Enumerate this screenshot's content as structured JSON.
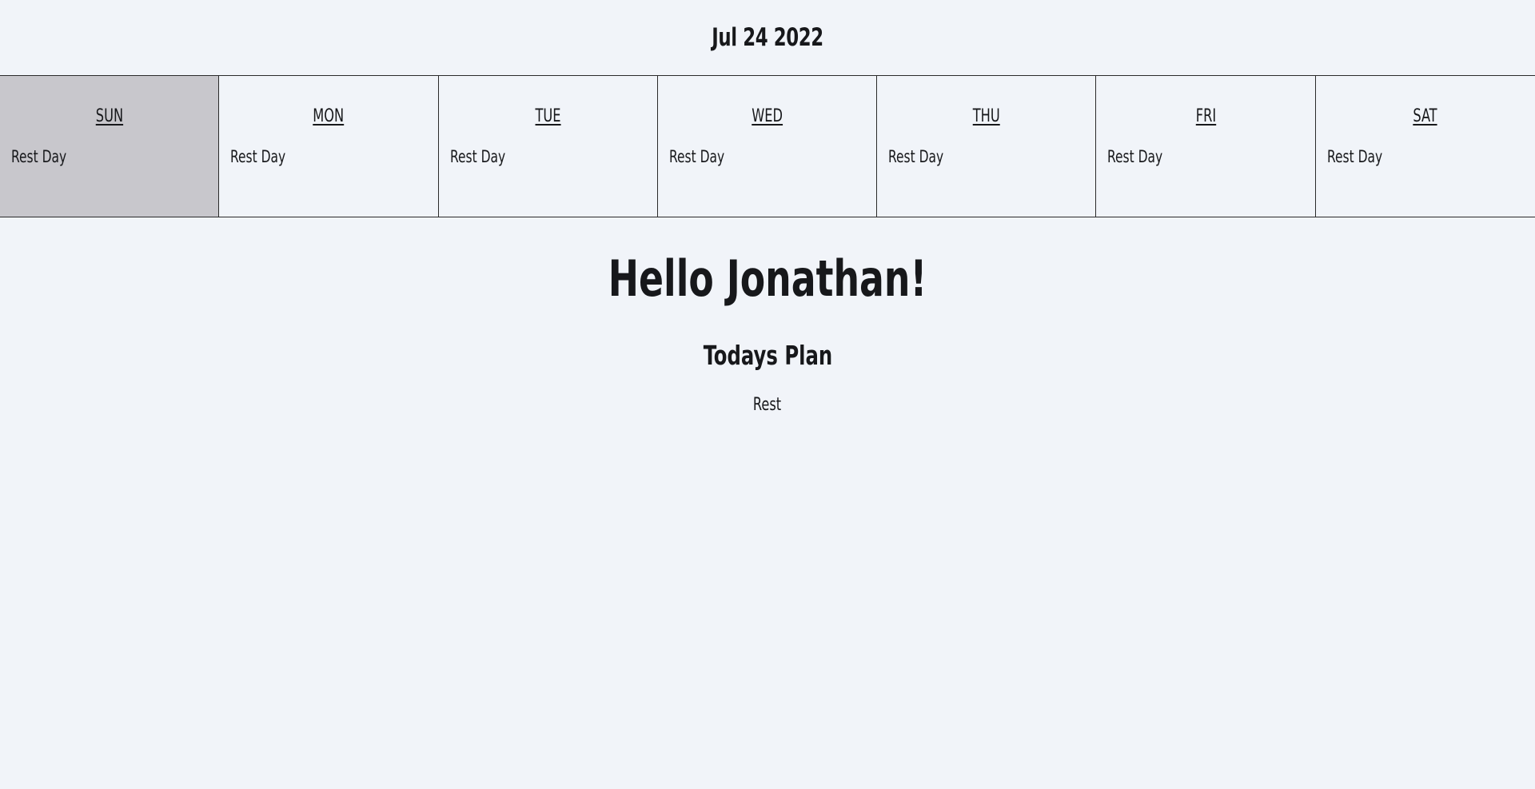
{
  "header": {
    "date": "Jul 24 2022"
  },
  "week": {
    "selected_index": 0,
    "days": [
      {
        "name": "SUN",
        "plan": "Rest Day"
      },
      {
        "name": "MON",
        "plan": "Rest Day"
      },
      {
        "name": "TUE",
        "plan": "Rest Day"
      },
      {
        "name": "WED",
        "plan": "Rest Day"
      },
      {
        "name": "THU",
        "plan": "Rest Day"
      },
      {
        "name": "FRI",
        "plan": "Rest Day"
      },
      {
        "name": "SAT",
        "plan": "Rest Day"
      }
    ]
  },
  "main": {
    "greeting": "Hello Jonathan!",
    "plan_title": "Todays Plan",
    "plan_text": "Rest"
  },
  "colors": {
    "background": "#f1f4f9",
    "selected_day": "#c8c7cc",
    "text": "#17181b",
    "border": "#2a2a2a"
  }
}
